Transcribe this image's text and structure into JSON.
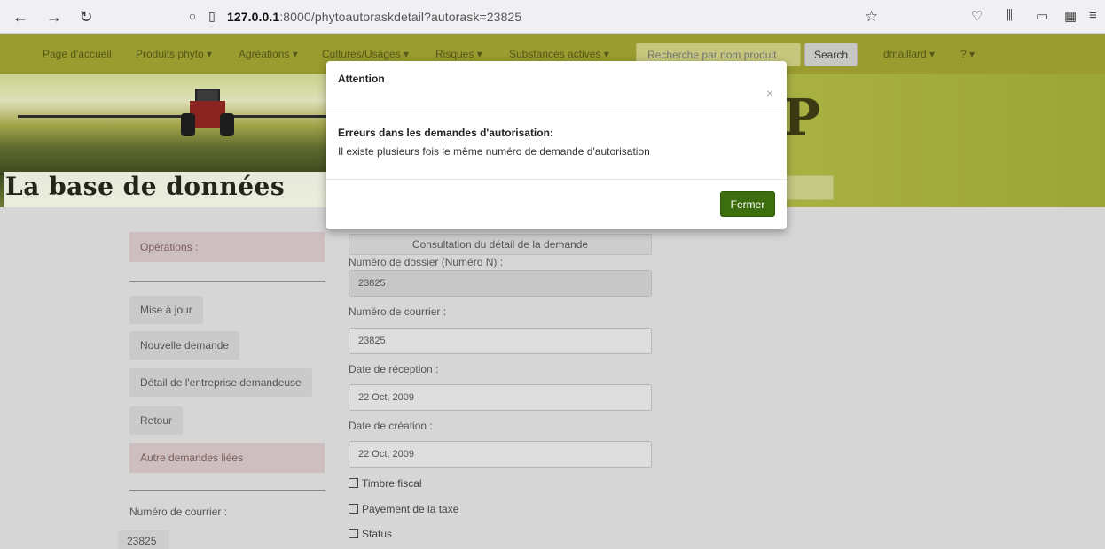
{
  "browser": {
    "url_host": "127.0.0.1",
    "url_path": ":8000/phytoautoraskdetail?autorask=23825"
  },
  "navbar": {
    "items": [
      "Page d'accueil",
      "Produits phyto ▾",
      "Agréations ▾",
      "Cultures/Usages ▾",
      "Risques ▾",
      "Substances actives ▾"
    ],
    "search_placeholder": "Recherche par nom produit",
    "search_button": "Search",
    "user": "dmaillard ▾",
    "help": "? ▾"
  },
  "banner": {
    "title": "La base de données",
    "logo_letter": "P"
  },
  "sidebar": {
    "operations_label": "Opérations :",
    "buttons": [
      "Mise à jour",
      "Nouvelle demande",
      "Détail de l'entreprise demandeuse",
      "Retour"
    ],
    "linked_label": "Autre demandes liées",
    "courier_label": "Numéro de courrier :",
    "courier_value": "23825"
  },
  "detail": {
    "header": "Consultation du détail de la demande",
    "dossier_label": "Numéro de dossier (Numéro N) :",
    "dossier_value": "23825",
    "courier_label": "Numéro de courrier :",
    "courier_value": "23825",
    "reception_label": "Date de réception :",
    "reception_value": "22 Oct, 2009",
    "creation_label": "Date de création :",
    "creation_value": "22 Oct, 2009",
    "checkboxes": [
      "Timbre fiscal",
      "Payement de la taxe",
      "Status"
    ]
  },
  "modal": {
    "title": "Attention",
    "close": "×",
    "body_title": "Erreurs dans les demandes d'autorisation:",
    "body_text": "Il existe plusieurs fois le même numéro de demande d'autorisation",
    "button": "Fermer"
  },
  "colors": {
    "navbar": "#9a9c2f",
    "modal_button": "#3c6e0f"
  }
}
